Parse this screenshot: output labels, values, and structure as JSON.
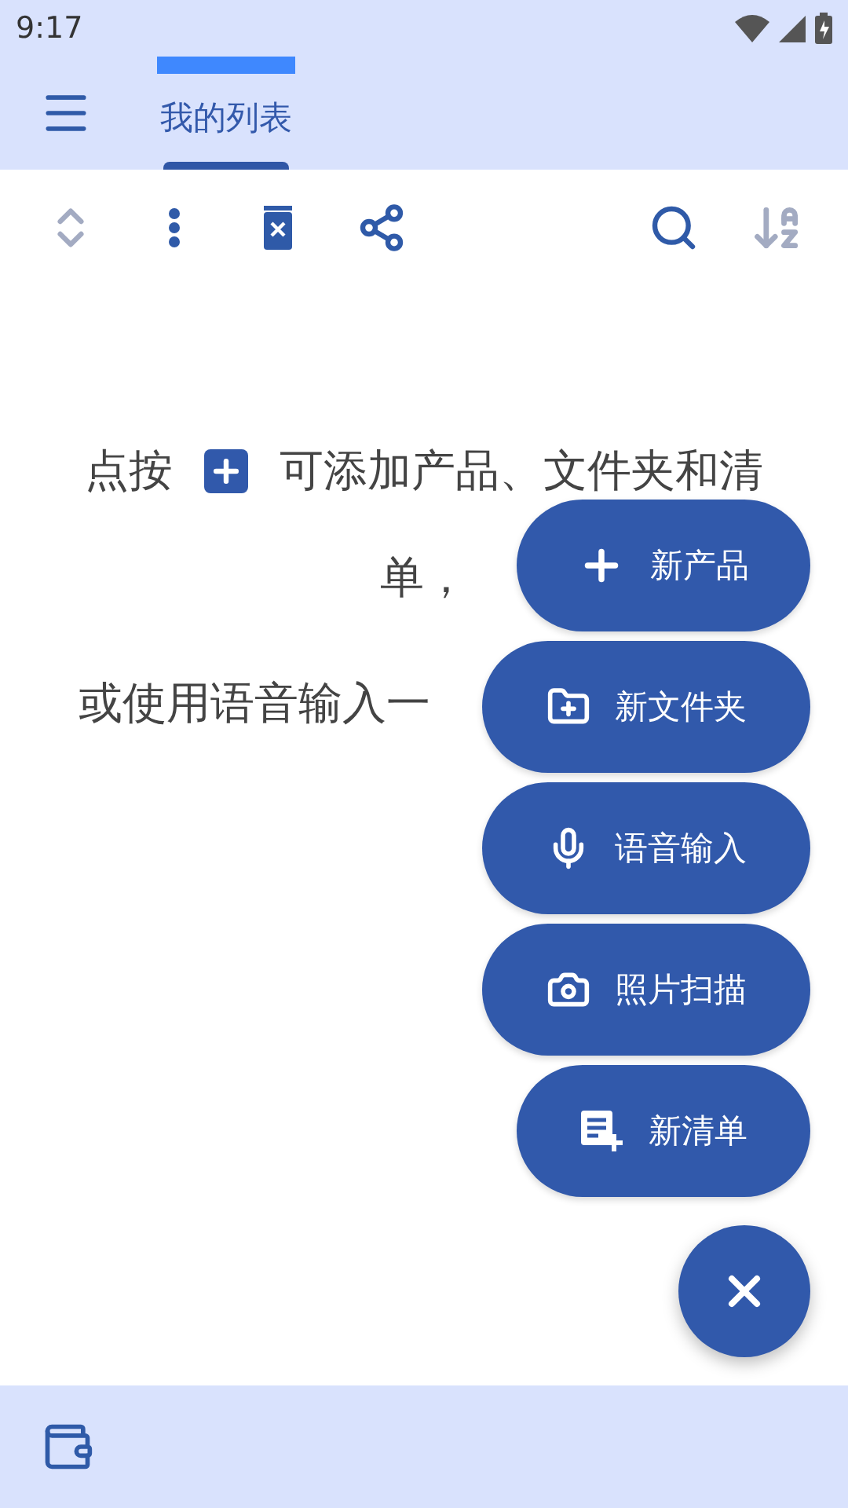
{
  "status_bar": {
    "time": "9:17"
  },
  "app_bar": {
    "tabs": [
      {
        "label": "我的列表",
        "selected": true
      }
    ]
  },
  "toolbar": [
    {
      "kind": "expand",
      "disabled": true
    },
    {
      "kind": "more",
      "disabled": false
    },
    {
      "kind": "delete",
      "disabled": false
    },
    {
      "kind": "share",
      "disabled": false
    },
    {
      "kind": "spacer"
    },
    {
      "kind": "search",
      "disabled": false
    },
    {
      "kind": "sort",
      "disabled": true
    }
  ],
  "hint": {
    "lead": "点按",
    "lines": [
      "可添加产品、文件夹和清",
      "单，",
      "或使用语音输入一"
    ]
  },
  "fab_menu": {
    "expanded": true,
    "actions": [
      {
        "kind": "plus",
        "label": "新产品"
      },
      {
        "kind": "folder",
        "label": "新文件夹"
      },
      {
        "kind": "mic",
        "label": "语音输入"
      },
      {
        "kind": "camera",
        "label": "照片扫描"
      },
      {
        "kind": "list",
        "label": "新清单"
      }
    ]
  }
}
